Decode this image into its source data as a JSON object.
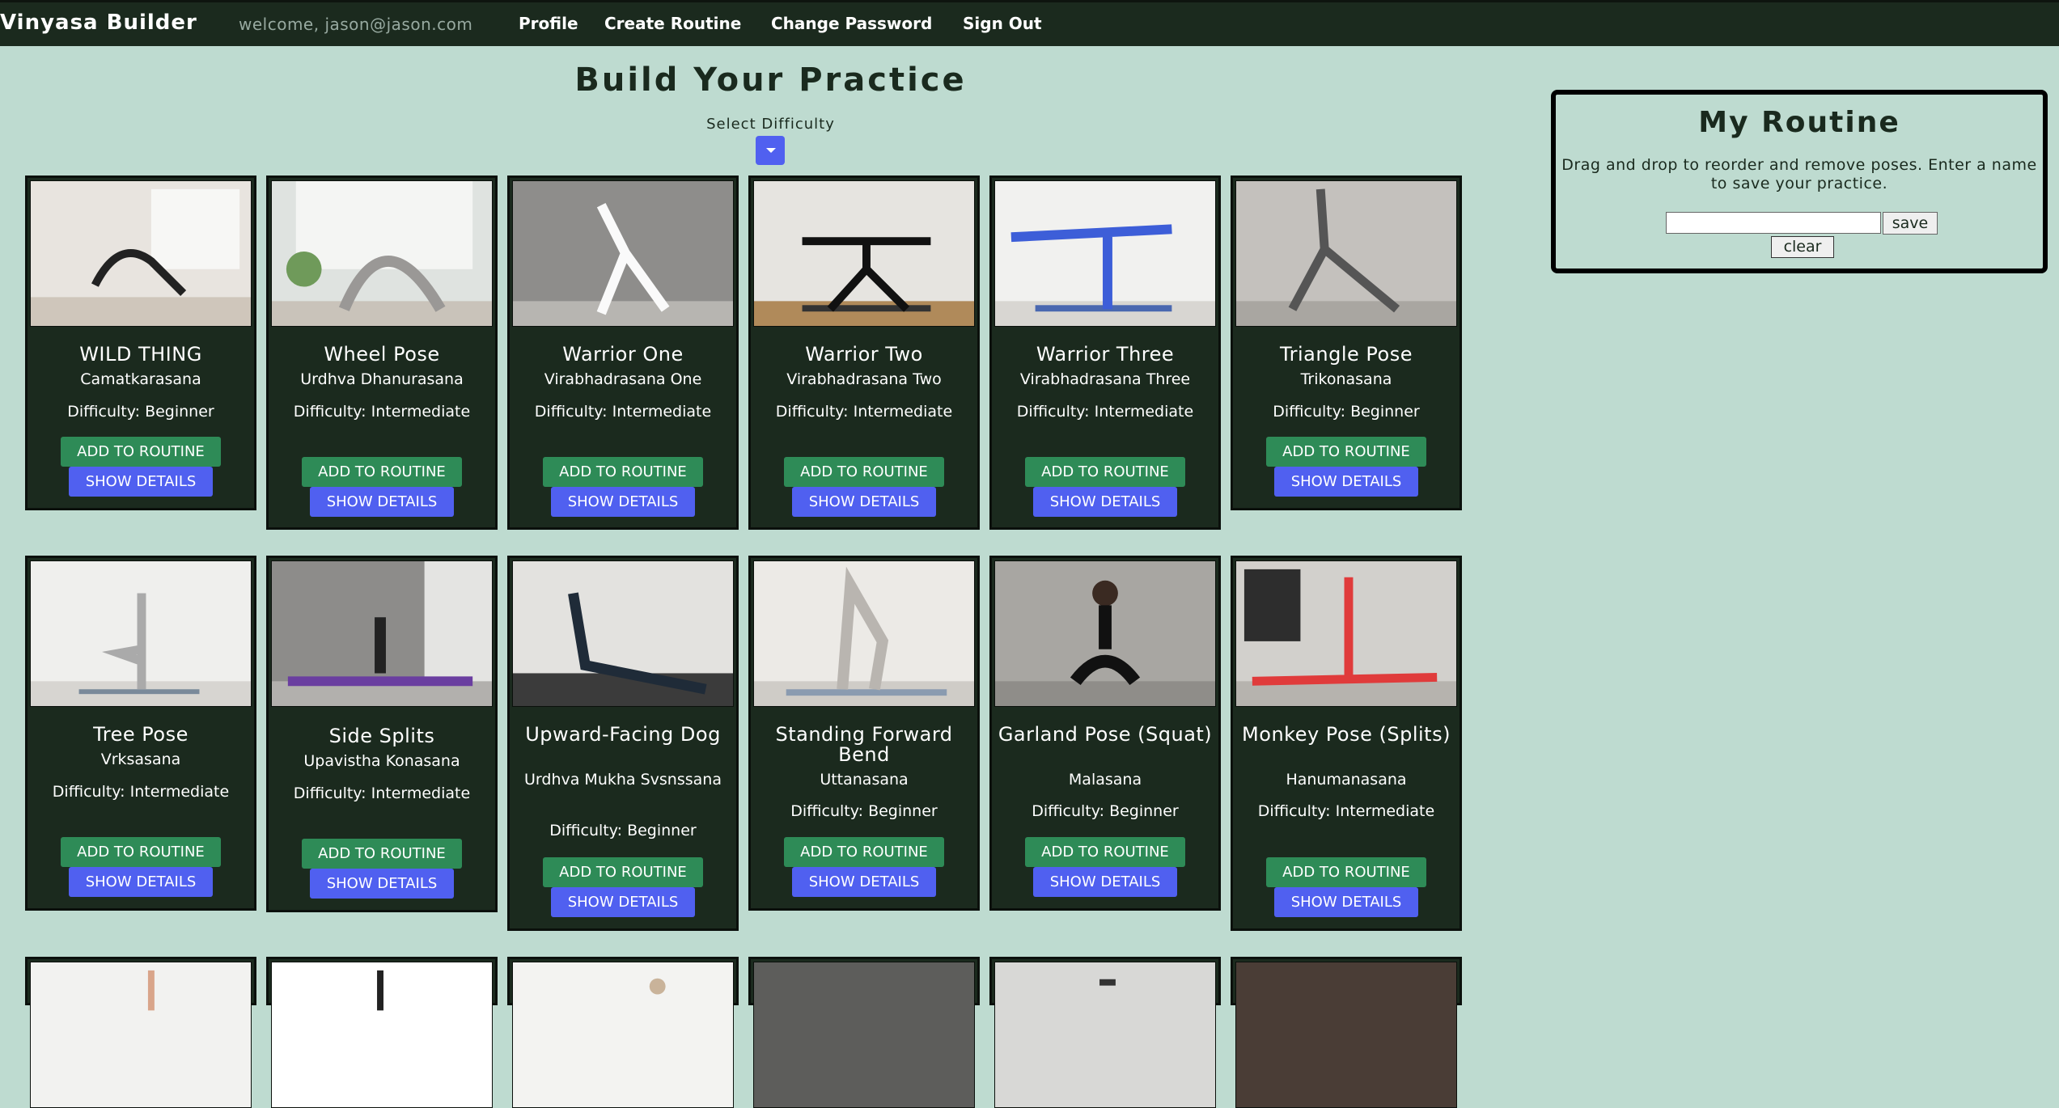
{
  "nav": {
    "brand": "Vinyasa Builder",
    "welcome": "welcome, jason@jason.com",
    "links": [
      "Profile",
      "Create Routine",
      "Change Password",
      "Sign Out"
    ]
  },
  "main": {
    "title": "Build Your Practice",
    "difficulty_label": "Select Difficulty"
  },
  "buttons": {
    "add": "ADD TO ROUTINE",
    "details": "SHOW DETAILS"
  },
  "poses": [
    {
      "name": "WILD THING",
      "sanskrit": "Camatkarasana",
      "difficulty": "Difficulty: Beginner"
    },
    {
      "name": "Wheel Pose",
      "sanskrit": "Urdhva Dhanurasana",
      "difficulty": "Difficulty: Intermediate"
    },
    {
      "name": "Warrior One",
      "sanskrit": "Virabhadrasana One",
      "difficulty": "Difficulty: Intermediate"
    },
    {
      "name": "Warrior Two",
      "sanskrit": "Virabhadrasana Two",
      "difficulty": "Difficulty: Intermediate"
    },
    {
      "name": "Warrior Three",
      "sanskrit": "Virabhadrasana Three",
      "difficulty": "Difficulty: Intermediate"
    },
    {
      "name": "Triangle Pose",
      "sanskrit": "Trikonasana",
      "difficulty": "Difficulty: Beginner"
    },
    {
      "name": "Tree Pose",
      "sanskrit": "Vrksasana",
      "difficulty": "Difficulty: Intermediate"
    },
    {
      "name": "Side Splits",
      "sanskrit": "Upavistha Konasana",
      "difficulty": "Difficulty: Intermediate"
    },
    {
      "name": "Upward-Facing Dog",
      "sanskrit": "Urdhva Mukha Svsnssana",
      "difficulty": "Difficulty: Beginner"
    },
    {
      "name": "Standing Forward Bend",
      "sanskrit": "Uttanasana",
      "difficulty": "Difficulty: Beginner"
    },
    {
      "name": "Garland Pose (Squat)",
      "sanskrit": "Malasana",
      "difficulty": "Difficulty: Beginner"
    },
    {
      "name": "Monkey Pose (Splits)",
      "sanskrit": "Hanumanasana",
      "difficulty": "Difficulty: Intermediate"
    }
  ],
  "routine": {
    "title": "My Routine",
    "instructions": "Drag and drop to reorder and remove poses. Enter a name to save your practice.",
    "name_value": "",
    "save_label": "save",
    "clear_label": "clear"
  }
}
